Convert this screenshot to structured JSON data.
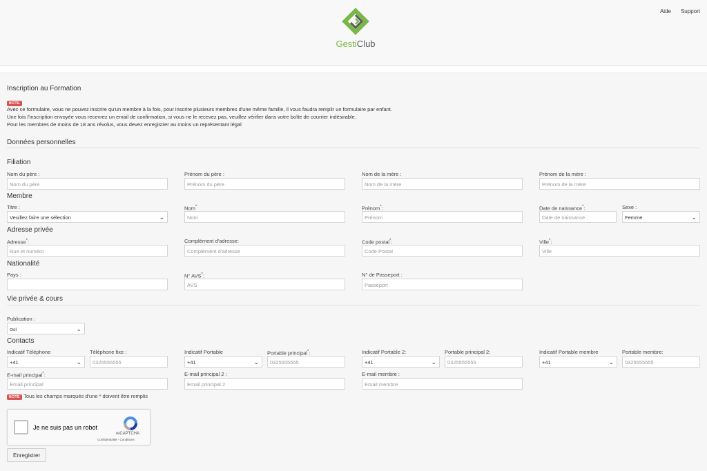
{
  "header": {
    "links": [
      "Aide",
      "Support"
    ],
    "logo_part1": "Gesti",
    "logo_part2": "Club",
    "colors": {
      "logo_green": "#7ab648",
      "logo_dark": "#5a5a5a"
    }
  },
  "form": {
    "title": "Inscription au Formation",
    "note_badge": "NOTE",
    "note_lines": [
      "Avec ce formulaire, vous ne pouvez inscrire qu'un membre à la fois, pour inscrire plusieurs membres d'une même famille, il vous faudra remplir un formulaire par enfant.",
      "Une fois l'inscription envoyée vous recevrez un email de confirmation, si vous ne le recevez pas, veuillez vérifier dans votre boîte de courrier indésirable.",
      "Pour les membres de moins de 18 ans révolus, vous devez enregistrer au moins un représentant légal"
    ],
    "section_personal": "Données personnelles",
    "filiation": {
      "title": "Filiation",
      "father_name_label": "Nom du père :",
      "father_name_placeholder": "Nom du père",
      "father_firstname_label": "Prénom du père :",
      "father_firstname_placeholder": "Prénom du père",
      "mother_name_label": "Nom de la mère :",
      "mother_name_placeholder": "Nom de la mère",
      "mother_firstname_label": "Prénom de la mère :",
      "mother_firstname_placeholder": "Prénom de la mère"
    },
    "membre": {
      "title": "Membre",
      "titre_label": "Titre :",
      "titre_value": "Veuillez faire une sélection",
      "nom_label": "Nom",
      "nom_placeholder": "Nom",
      "prenom_label": "Prénom",
      "prenom_placeholder": "Prénom",
      "dob_label": "Date de naissance",
      "dob_placeholder": "Date de naissance",
      "sexe_label": "Sexe :",
      "sexe_value": "Femme"
    },
    "adresse": {
      "title": "Adresse privée",
      "adresse_label": "Adresse",
      "adresse_placeholder": "Rue et numéro",
      "complement_label": "Complément d'adresse:",
      "complement_placeholder": "Complément d'adresse",
      "cp_label": "Code postal",
      "cp_placeholder": "Code Postal",
      "ville_label": "Ville",
      "ville_placeholder": "Ville"
    },
    "nationalite": {
      "title": "Nationalité",
      "pays_label": "Pays :",
      "pays_placeholder": "",
      "avs_label": "N° AVS",
      "avs_placeholder": "AVS",
      "passeport_label": "N° de Passeport :",
      "passeport_placeholder": "Passeport"
    },
    "vie_privee": {
      "title": "Vie privée & cours",
      "publication_label": "Publication :",
      "publication_value": "oui"
    },
    "contacts": {
      "title": "Contacts",
      "ind_tel_label": "Indicatif Téléphone",
      "ind_tel_value": "+41",
      "tel_fixe_label": "Téléphone fixe :",
      "tel_fixe_placeholder": "0325555555",
      "ind_port_label": "Indicatif Portable",
      "ind_port_value": "+41",
      "port_principal_label": "Portable principal",
      "port_principal_placeholder": "0325555555",
      "ind_port2_label": "Indicatif Portable 2:",
      "ind_port2_value": "+41",
      "port2_label": "Portable principal 2:",
      "port2_placeholder": "0325555555",
      "ind_port_membre_label": "Indicatif Portable membre",
      "ind_port_membre_value": "+41",
      "port_membre_label": "Portable membre:",
      "port_membre_placeholder": "0325555555",
      "email_label": "E-mail principal",
      "email_placeholder": "Email principal",
      "email2_label": "E-mail principal 2 :",
      "email2_placeholder": "Email principal 2",
      "email_membre_label": "E-mail membre :",
      "email_membre_placeholder": "Email membre"
    },
    "required_note": "Tous les champs marqués d'une * doivent être remplis",
    "required_star": "*",
    "captcha": {
      "label": "Je ne suis pas un robot",
      "brand": "reCAPTCHA",
      "links": "Confidentialité - Conditions"
    },
    "submit_label": "Enregistrer"
  }
}
